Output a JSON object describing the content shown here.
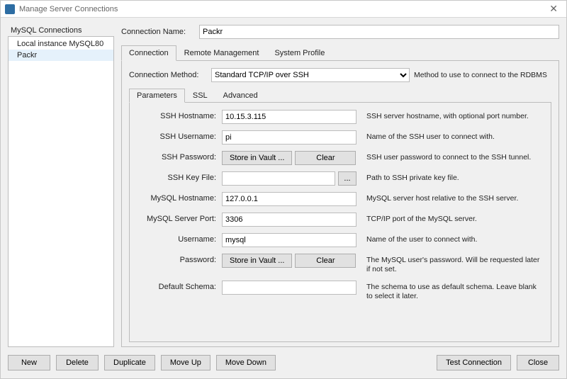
{
  "window": {
    "title": "Manage Server Connections"
  },
  "sidebar": {
    "header": "MySQL Connections",
    "items": [
      "Local instance MySQL80",
      "Packr"
    ],
    "selected_index": 1
  },
  "connection_name": {
    "label": "Connection Name:",
    "value": "Packr"
  },
  "tabs": {
    "items": [
      "Connection",
      "Remote Management",
      "System Profile"
    ],
    "active_index": 0
  },
  "method": {
    "label": "Connection Method:",
    "value": "Standard TCP/IP over SSH",
    "desc": "Method to use to connect to the RDBMS"
  },
  "subtabs": {
    "items": [
      "Parameters",
      "SSL",
      "Advanced"
    ],
    "active_index": 0
  },
  "fields": {
    "ssh_hostname": {
      "label": "SSH Hostname:",
      "value": "10.15.3.115",
      "help": "SSH server hostname, with  optional port number."
    },
    "ssh_username": {
      "label": "SSH Username:",
      "value": "pi",
      "help": "Name of the SSH user to connect with."
    },
    "ssh_password": {
      "label": "SSH Password:",
      "store": "Store in Vault ...",
      "clear": "Clear",
      "help": "SSH user password to connect to the SSH tunnel."
    },
    "ssh_keyfile": {
      "label": "SSH Key File:",
      "value": "",
      "browse": "...",
      "help": "Path to SSH private key file."
    },
    "mysql_hostname": {
      "label": "MySQL Hostname:",
      "value": "127.0.0.1",
      "help": "MySQL server host relative to the SSH server."
    },
    "mysql_port": {
      "label": "MySQL Server Port:",
      "value": "3306",
      "help": "TCP/IP port of the MySQL server."
    },
    "username": {
      "label": "Username:",
      "value": "mysql",
      "help": "Name of the user to connect with."
    },
    "password": {
      "label": "Password:",
      "store": "Store in Vault ...",
      "clear": "Clear",
      "help": "The MySQL user's password. Will be requested later if not set."
    },
    "default_schema": {
      "label": "Default Schema:",
      "value": "",
      "help": "The schema to use as default schema. Leave blank to select it later."
    }
  },
  "footer": {
    "new": "New",
    "delete": "Delete",
    "duplicate": "Duplicate",
    "move_up": "Move Up",
    "move_down": "Move Down",
    "test": "Test Connection",
    "close": "Close"
  }
}
